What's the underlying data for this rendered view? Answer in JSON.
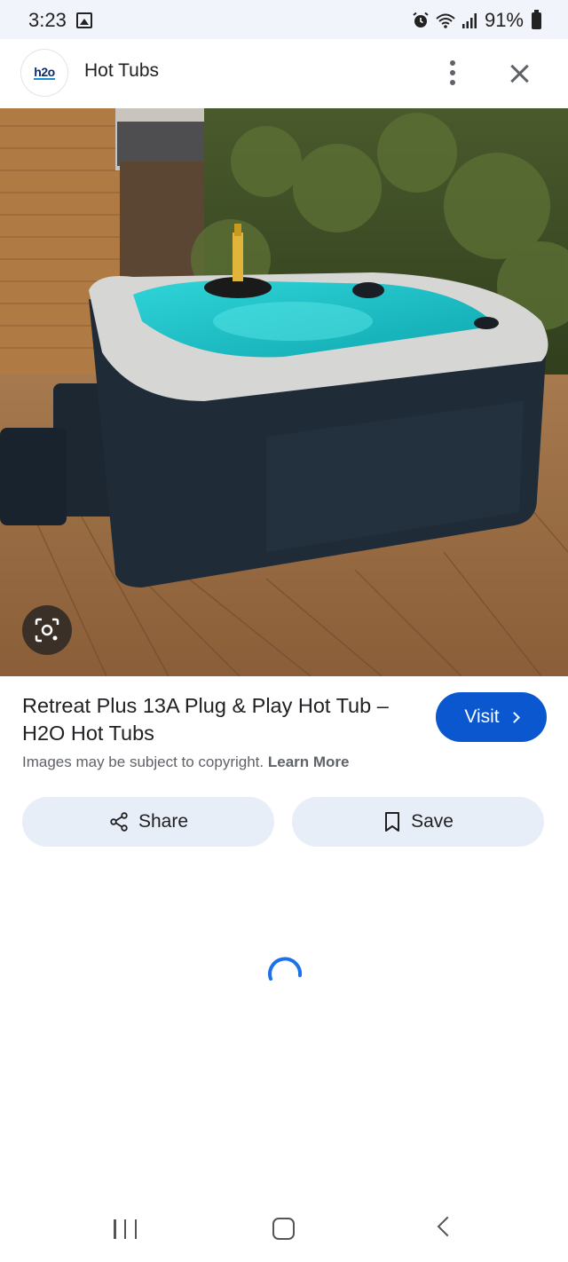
{
  "status_bar": {
    "time": "3:23",
    "battery": "91%",
    "icons": [
      "image-icon",
      "alarm-icon",
      "wifi-icon",
      "signal-icon",
      "battery-icon"
    ]
  },
  "header": {
    "logo_text": "h2o",
    "title": "Hot Tubs",
    "icons": [
      "more-vert-icon",
      "close-icon"
    ]
  },
  "image": {
    "subject": "hot tub on a wooden deck",
    "lens_icon": "google-lens-icon"
  },
  "result": {
    "title": "Retreat Plus 13A Plug & Play Hot Tub – H2O Hot Tubs",
    "visit_label": "Visit",
    "copyright_text": "Images may be subject to copyright.",
    "learn_more": "Learn More"
  },
  "actions": {
    "share_label": "Share",
    "save_label": "Save"
  },
  "colors": {
    "accent": "#0b57d0",
    "pill_bg": "#e8eef8",
    "spinner": "#1a73e8"
  },
  "nav_bar": {
    "icons": [
      "recent-apps-icon",
      "home-icon",
      "back-icon"
    ]
  }
}
